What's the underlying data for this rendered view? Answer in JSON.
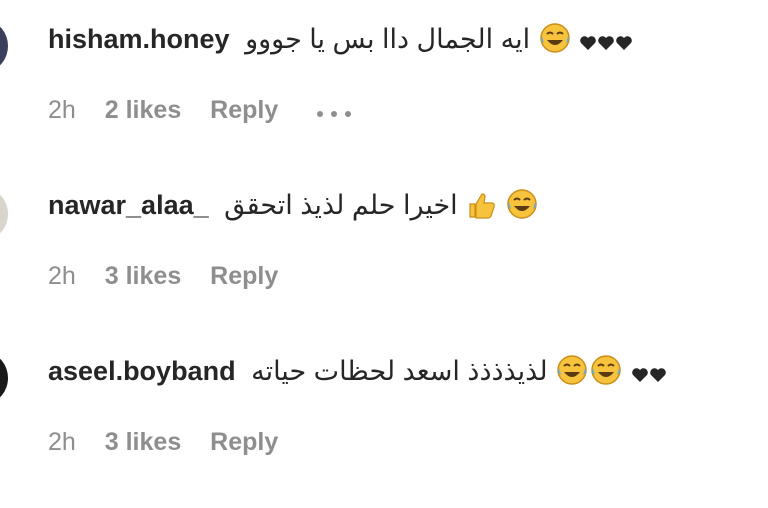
{
  "comments": [
    {
      "username": "hisham.honey",
      "text": "ايه الجمال داا بس يا جووو",
      "time": "2h",
      "likes": "2 likes",
      "reply": "Reply",
      "avatar_color": "#3b3f5c",
      "emoji_icon": "laughing-crying-face-icon",
      "hearts": 3,
      "has_more": true
    },
    {
      "username": "nawar_alaa_",
      "text": "اخيرا حلم لذيذ اتحقق",
      "time": "2h",
      "likes": "3 likes",
      "reply": "Reply",
      "avatar_color": "#d9d5cc",
      "emoji_icon": "laughing-crying-face-icon",
      "thumbs_icon": "thumbs-up-icon",
      "has_more": false
    },
    {
      "username": "aseel.boyband",
      "text": "لذيذذذذ اسعد لحظات حياته",
      "time": "2h",
      "likes": "3 likes",
      "reply": "Reply",
      "avatar_color": "#1a1a1a",
      "emoji_icon": "laughing-crying-face-icon",
      "hearts": 2,
      "has_more": false
    }
  ],
  "colors": {
    "text": "#262626",
    "meta": "#8e8e8e",
    "heart": "#262626",
    "emoji_face": "#f7c23c"
  }
}
